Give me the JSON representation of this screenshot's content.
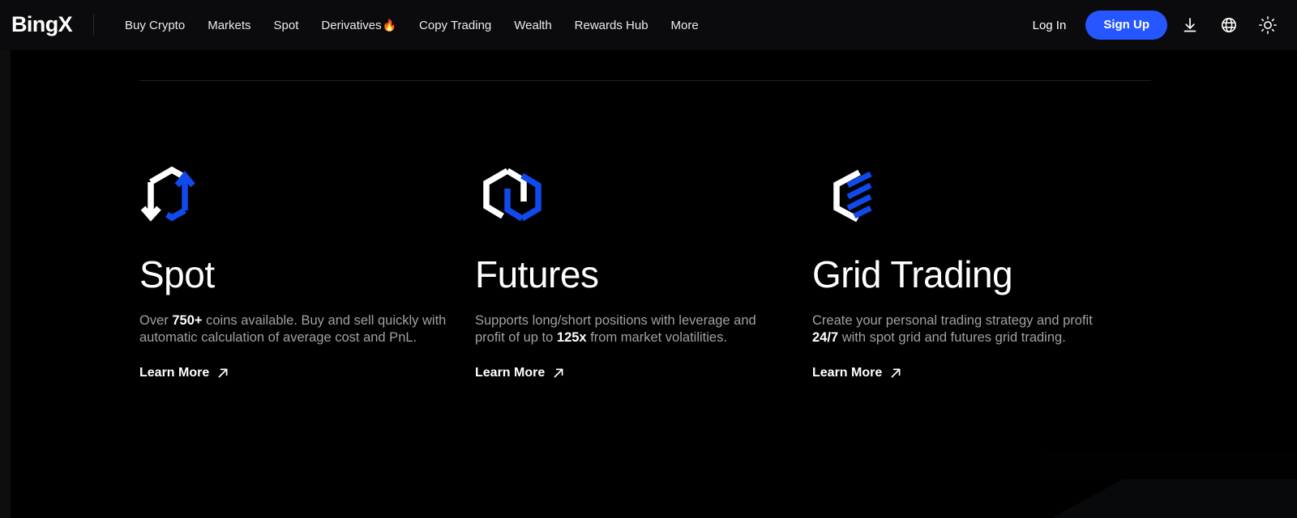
{
  "header": {
    "logo": "BingX",
    "nav_items": [
      {
        "label": "Buy Crypto",
        "badge": ""
      },
      {
        "label": "Markets",
        "badge": ""
      },
      {
        "label": "Spot",
        "badge": ""
      },
      {
        "label": "Derivatives",
        "badge": "🔥"
      },
      {
        "label": "Copy Trading",
        "badge": ""
      },
      {
        "label": "Wealth",
        "badge": ""
      },
      {
        "label": "Rewards Hub",
        "badge": ""
      },
      {
        "label": "More",
        "badge": ""
      }
    ],
    "login_label": "Log In",
    "signup_label": "Sign Up",
    "icons": [
      {
        "name": "download-icon"
      },
      {
        "name": "globe-icon"
      },
      {
        "name": "brightness-icon"
      }
    ],
    "accent_color": "#2556ff",
    "background_color": "#0b0b0d"
  },
  "main": {
    "cards": [
      {
        "icon_name": "spot-swap-arrows-icon",
        "title": "Spot",
        "desc_pre": "Over ",
        "desc_bold": "750+",
        "desc_post": " coins available. Buy and sell quickly with automatic calculation of average cost and PnL.",
        "link_label": "Learn More"
      },
      {
        "icon_name": "futures-interlocking-hexagons-icon",
        "title": "Futures",
        "desc_pre": "Supports long/short positions with leverage and profit of up to ",
        "desc_bold": "125x",
        "desc_post": " from market volatilities.",
        "link_label": "Learn More"
      },
      {
        "icon_name": "grid-trading-bars-icon",
        "title": "Grid Trading",
        "desc_pre": "Create your personal trading strategy and profit ",
        "desc_bold": "24/7",
        "desc_post": " with spot grid and futures grid trading.",
        "link_label": "Learn More"
      }
    ],
    "link_arrow_icon": "arrow-up-right-icon",
    "brand_blue": "#1049ec",
    "text_muted": "#9fa1a6",
    "background_color": "#000000"
  }
}
